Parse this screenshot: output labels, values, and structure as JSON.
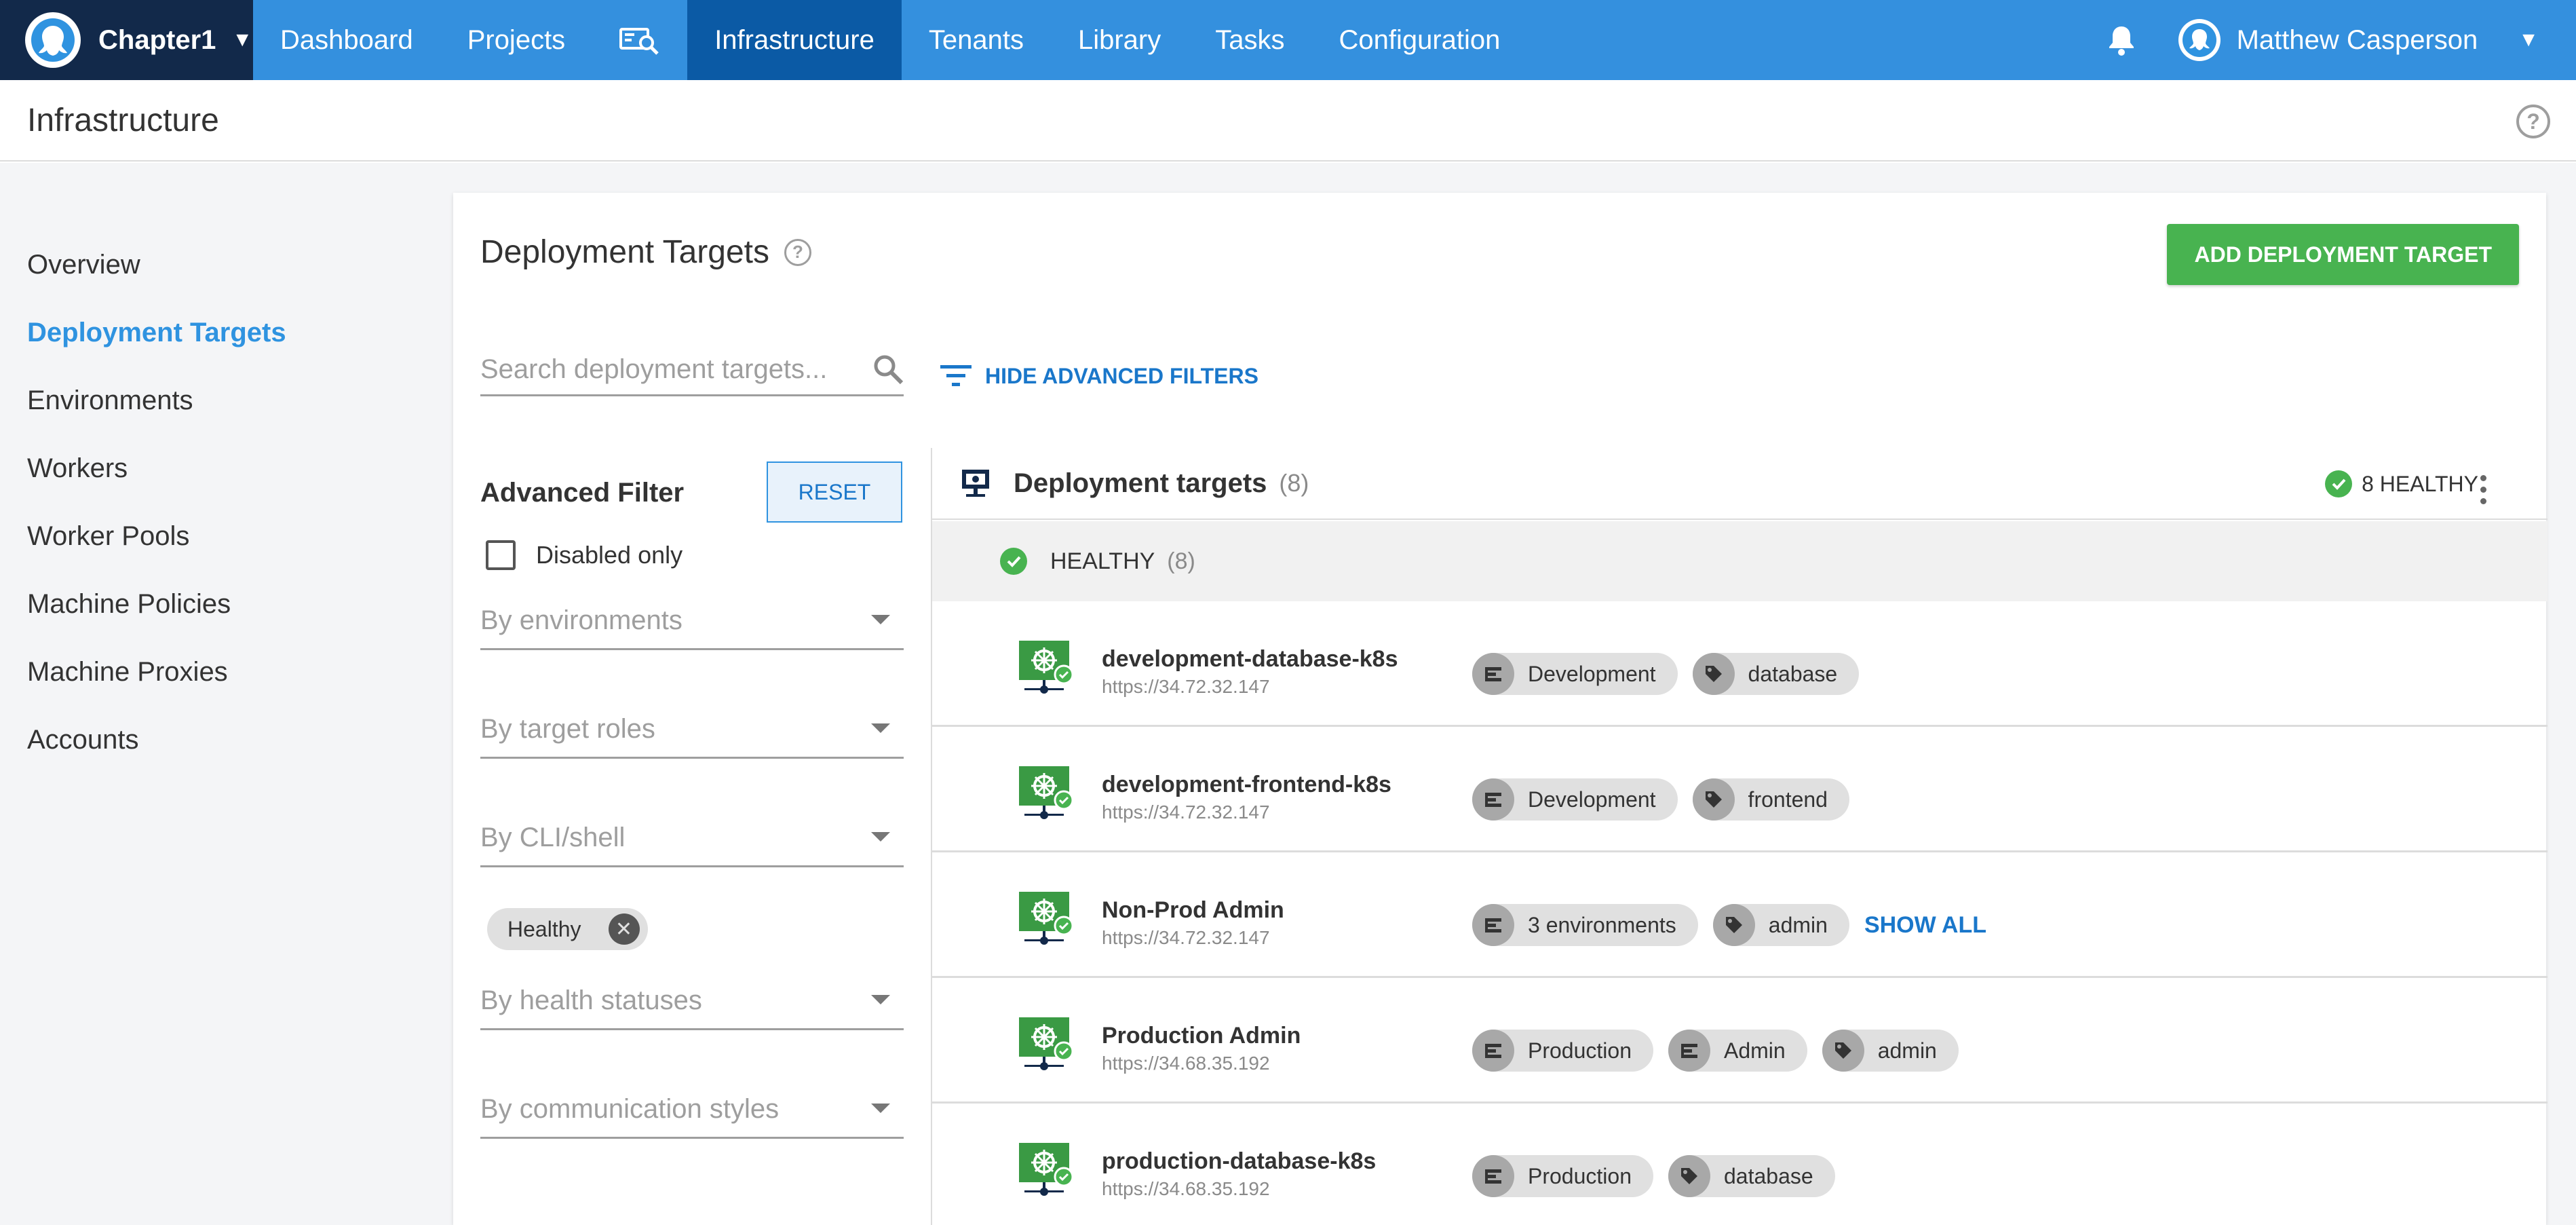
{
  "topnav": {
    "space_name": "Chapter1",
    "items": [
      {
        "label": "Dashboard"
      },
      {
        "label": "Projects"
      },
      {
        "label": "Infrastructure"
      },
      {
        "label": "Tenants"
      },
      {
        "label": "Library"
      },
      {
        "label": "Tasks"
      },
      {
        "label": "Configuration"
      }
    ],
    "active_item": "Infrastructure",
    "user_name": "Matthew Casperson",
    "icons": [
      "space-logo-icon",
      "chevron-down-icon",
      "search-machine-icon",
      "bell-icon",
      "user-avatar-icon"
    ]
  },
  "page": {
    "title": "Infrastructure",
    "help_glyph": "?"
  },
  "sidebar": {
    "items": [
      {
        "label": "Overview"
      },
      {
        "label": "Deployment Targets"
      },
      {
        "label": "Environments"
      },
      {
        "label": "Workers"
      },
      {
        "label": "Worker Pools"
      },
      {
        "label": "Machine Policies"
      },
      {
        "label": "Machine Proxies"
      },
      {
        "label": "Accounts"
      }
    ],
    "active_item": "Deployment Targets"
  },
  "panel": {
    "title": "Deployment Targets",
    "help_glyph": "?",
    "add_button": "ADD DEPLOYMENT TARGET",
    "search_placeholder": "Search deployment targets...",
    "hide_filters": "HIDE ADVANCED FILTERS"
  },
  "filters": {
    "title": "Advanced Filter",
    "reset": "RESET",
    "disabled_only": "Disabled only",
    "disabled_only_checked": false,
    "environments": "By environments",
    "target_roles": "By target roles",
    "cli_shell": "By CLI/shell",
    "health_chip": "Healthy",
    "health_statuses": "By health statuses",
    "communication_styles": "By communication styles"
  },
  "targets": {
    "header_title": "Deployment targets",
    "header_count": "(8)",
    "health_summary": "8 HEALTHY",
    "group_label": "HEALTHY",
    "group_count": "(8)",
    "rows": [
      {
        "name": "development-database-k8s",
        "url": "https://34.72.32.147",
        "tags": [
          {
            "type": "environment",
            "label": "Development"
          },
          {
            "type": "role",
            "label": "database"
          }
        ],
        "show_all": ""
      },
      {
        "name": "development-frontend-k8s",
        "url": "https://34.72.32.147",
        "tags": [
          {
            "type": "environment",
            "label": "Development"
          },
          {
            "type": "role",
            "label": "frontend"
          }
        ],
        "show_all": ""
      },
      {
        "name": "Non-Prod Admin",
        "url": "https://34.72.32.147",
        "tags": [
          {
            "type": "environment",
            "label": "3 environments"
          },
          {
            "type": "role",
            "label": "admin"
          }
        ],
        "show_all": "SHOW ALL"
      },
      {
        "name": "Production Admin",
        "url": "https://34.68.35.192",
        "tags": [
          {
            "type": "environment",
            "label": "Production"
          },
          {
            "type": "environment",
            "label": "Admin"
          },
          {
            "type": "role",
            "label": "admin"
          }
        ],
        "show_all": ""
      },
      {
        "name": "production-database-k8s",
        "url": "https://34.68.35.192",
        "tags": [
          {
            "type": "environment",
            "label": "Production"
          },
          {
            "type": "role",
            "label": "database"
          }
        ],
        "show_all": ""
      }
    ]
  },
  "colors": {
    "nav_blue": "#3490de",
    "nav_active": "#0b5aa5",
    "space_bg": "#12294a",
    "healthy_green": "#48b350",
    "link_blue": "#1a77ca",
    "k8s_tile_green": "#3a9a44"
  }
}
